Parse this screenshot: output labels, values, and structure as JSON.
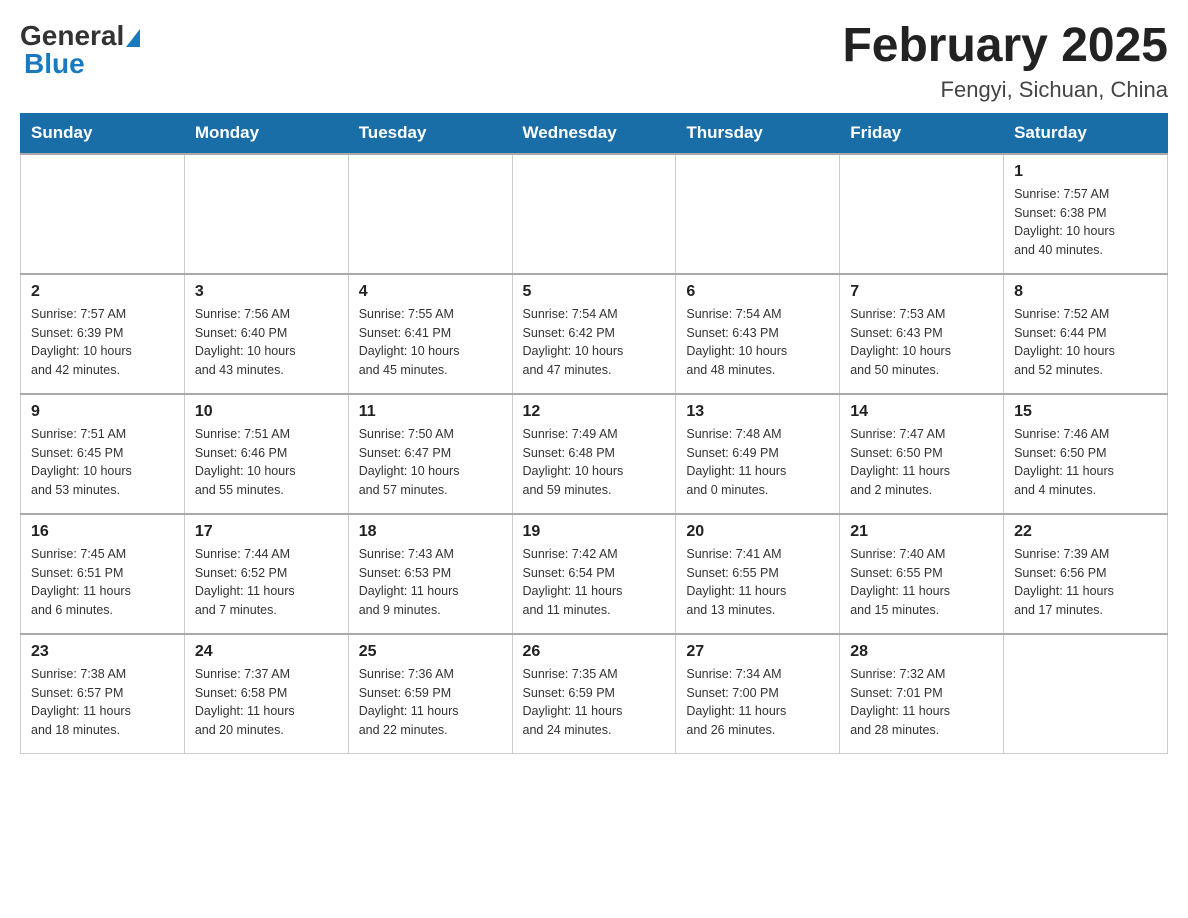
{
  "header": {
    "logo_general": "General",
    "logo_blue": "Blue",
    "title": "February 2025",
    "subtitle": "Fengyi, Sichuan, China"
  },
  "days_of_week": [
    "Sunday",
    "Monday",
    "Tuesday",
    "Wednesday",
    "Thursday",
    "Friday",
    "Saturday"
  ],
  "weeks": [
    [
      {
        "day": "",
        "info": ""
      },
      {
        "day": "",
        "info": ""
      },
      {
        "day": "",
        "info": ""
      },
      {
        "day": "",
        "info": ""
      },
      {
        "day": "",
        "info": ""
      },
      {
        "day": "",
        "info": ""
      },
      {
        "day": "1",
        "info": "Sunrise: 7:57 AM\nSunset: 6:38 PM\nDaylight: 10 hours\nand 40 minutes."
      }
    ],
    [
      {
        "day": "2",
        "info": "Sunrise: 7:57 AM\nSunset: 6:39 PM\nDaylight: 10 hours\nand 42 minutes."
      },
      {
        "day": "3",
        "info": "Sunrise: 7:56 AM\nSunset: 6:40 PM\nDaylight: 10 hours\nand 43 minutes."
      },
      {
        "day": "4",
        "info": "Sunrise: 7:55 AM\nSunset: 6:41 PM\nDaylight: 10 hours\nand 45 minutes."
      },
      {
        "day": "5",
        "info": "Sunrise: 7:54 AM\nSunset: 6:42 PM\nDaylight: 10 hours\nand 47 minutes."
      },
      {
        "day": "6",
        "info": "Sunrise: 7:54 AM\nSunset: 6:43 PM\nDaylight: 10 hours\nand 48 minutes."
      },
      {
        "day": "7",
        "info": "Sunrise: 7:53 AM\nSunset: 6:43 PM\nDaylight: 10 hours\nand 50 minutes."
      },
      {
        "day": "8",
        "info": "Sunrise: 7:52 AM\nSunset: 6:44 PM\nDaylight: 10 hours\nand 52 minutes."
      }
    ],
    [
      {
        "day": "9",
        "info": "Sunrise: 7:51 AM\nSunset: 6:45 PM\nDaylight: 10 hours\nand 53 minutes."
      },
      {
        "day": "10",
        "info": "Sunrise: 7:51 AM\nSunset: 6:46 PM\nDaylight: 10 hours\nand 55 minutes."
      },
      {
        "day": "11",
        "info": "Sunrise: 7:50 AM\nSunset: 6:47 PM\nDaylight: 10 hours\nand 57 minutes."
      },
      {
        "day": "12",
        "info": "Sunrise: 7:49 AM\nSunset: 6:48 PM\nDaylight: 10 hours\nand 59 minutes."
      },
      {
        "day": "13",
        "info": "Sunrise: 7:48 AM\nSunset: 6:49 PM\nDaylight: 11 hours\nand 0 minutes."
      },
      {
        "day": "14",
        "info": "Sunrise: 7:47 AM\nSunset: 6:50 PM\nDaylight: 11 hours\nand 2 minutes."
      },
      {
        "day": "15",
        "info": "Sunrise: 7:46 AM\nSunset: 6:50 PM\nDaylight: 11 hours\nand 4 minutes."
      }
    ],
    [
      {
        "day": "16",
        "info": "Sunrise: 7:45 AM\nSunset: 6:51 PM\nDaylight: 11 hours\nand 6 minutes."
      },
      {
        "day": "17",
        "info": "Sunrise: 7:44 AM\nSunset: 6:52 PM\nDaylight: 11 hours\nand 7 minutes."
      },
      {
        "day": "18",
        "info": "Sunrise: 7:43 AM\nSunset: 6:53 PM\nDaylight: 11 hours\nand 9 minutes."
      },
      {
        "day": "19",
        "info": "Sunrise: 7:42 AM\nSunset: 6:54 PM\nDaylight: 11 hours\nand 11 minutes."
      },
      {
        "day": "20",
        "info": "Sunrise: 7:41 AM\nSunset: 6:55 PM\nDaylight: 11 hours\nand 13 minutes."
      },
      {
        "day": "21",
        "info": "Sunrise: 7:40 AM\nSunset: 6:55 PM\nDaylight: 11 hours\nand 15 minutes."
      },
      {
        "day": "22",
        "info": "Sunrise: 7:39 AM\nSunset: 6:56 PM\nDaylight: 11 hours\nand 17 minutes."
      }
    ],
    [
      {
        "day": "23",
        "info": "Sunrise: 7:38 AM\nSunset: 6:57 PM\nDaylight: 11 hours\nand 18 minutes."
      },
      {
        "day": "24",
        "info": "Sunrise: 7:37 AM\nSunset: 6:58 PM\nDaylight: 11 hours\nand 20 minutes."
      },
      {
        "day": "25",
        "info": "Sunrise: 7:36 AM\nSunset: 6:59 PM\nDaylight: 11 hours\nand 22 minutes."
      },
      {
        "day": "26",
        "info": "Sunrise: 7:35 AM\nSunset: 6:59 PM\nDaylight: 11 hours\nand 24 minutes."
      },
      {
        "day": "27",
        "info": "Sunrise: 7:34 AM\nSunset: 7:00 PM\nDaylight: 11 hours\nand 26 minutes."
      },
      {
        "day": "28",
        "info": "Sunrise: 7:32 AM\nSunset: 7:01 PM\nDaylight: 11 hours\nand 28 minutes."
      },
      {
        "day": "",
        "info": ""
      }
    ]
  ]
}
